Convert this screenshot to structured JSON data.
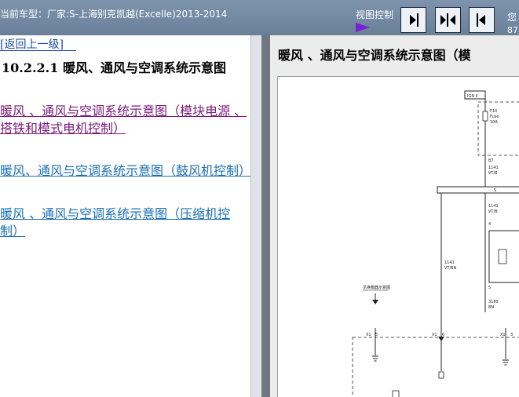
{
  "topbar": {
    "vehicle_label": "当前车型：厂家:S-上海别克凯越(Excelle)2013-2014",
    "view_control_label": "视图控制",
    "corner_top": "您",
    "corner_bottom": "87("
  },
  "nav": {
    "back_link": "[返回上一级]",
    "section_title": "10.2.2.1  暖风、通风与空调系统示意图",
    "links": [
      "暖风 、通风与空调系统示意图（模块电源 、 搭铁和模式电机控制）",
      "暖风、通风与空调系统示意图（鼓风机控制）",
      "暖风 、通风与空调系统示意图（压缩机控制）"
    ]
  },
  "diagram": {
    "title": "暖风 、通风与空调系统示意图（模",
    "labels": {
      "ign": "IGN II",
      "fuse": "F10",
      "fuse_sub": "Fuse",
      "fuse_amp": "10A",
      "b7": "B7",
      "wire_top": "1141",
      "wire_top_color": "VT/B",
      "splice": "S",
      "wire_mid": "1141",
      "wire_mid_color": "VT/B",
      "pin4": "4",
      "wire_left": "1141",
      "wire_left_color": "VT/BN",
      "pin5": "5",
      "wire_low": "3189",
      "wire_low_color": "BN",
      "ref_note": "见换箱器示意图",
      "conn_a": "X1",
      "conn_a_pin": "5",
      "conn_b": "X1",
      "conn_b_pin": "6",
      "conn_c": "X1",
      "conn_c_pin": "3"
    }
  },
  "colors": {
    "topbar": "#7e93ad",
    "visited_link": "#7a1a7a",
    "link": "#1a6fb5",
    "play_icon": "#7b1fd6"
  }
}
